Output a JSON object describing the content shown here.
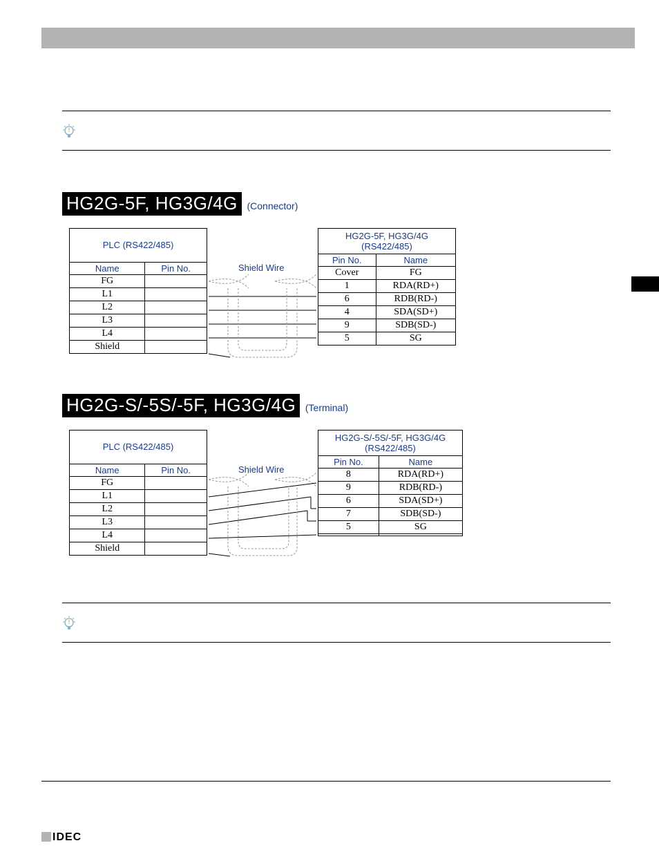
{
  "badge1": "HG2G-5F, HG3G/4G",
  "suffix1": "(Connector)",
  "badge2": "HG2G-S/-5S/-5F, HG3G/4G",
  "suffix2": "(Terminal)",
  "shieldLabel": "Shield Wire",
  "left": {
    "title": "PLC (RS422/485)",
    "hName": "Name",
    "hPin": "Pin No.",
    "rows": [
      "FG",
      "L1",
      "L2",
      "L3",
      "L4",
      "Shield"
    ]
  },
  "rightA": {
    "title1": "HG2G-5F, HG3G/4G",
    "title2": "(RS422/485)",
    "hPin": "Pin No.",
    "hName": "Name",
    "rows": [
      {
        "p": "Cover",
        "n": "FG"
      },
      {
        "p": "1",
        "n": "RDA(RD+)"
      },
      {
        "p": "6",
        "n": "RDB(RD-)"
      },
      {
        "p": "4",
        "n": "SDA(SD+)"
      },
      {
        "p": "9",
        "n": "SDB(SD-)"
      },
      {
        "p": "5",
        "n": "SG"
      }
    ]
  },
  "rightB": {
    "title1": "HG2G-S/-5S/-5F, HG3G/4G",
    "title2": "(RS422/485)",
    "hPin": "Pin No.",
    "hName": "Name",
    "rows": [
      {
        "p": "8",
        "n": "RDA(RD+)"
      },
      {
        "p": "9",
        "n": "RDB(RD-)"
      },
      {
        "p": "6",
        "n": "SDA(SD+)"
      },
      {
        "p": "7",
        "n": "SDB(SD-)"
      },
      {
        "p": "5",
        "n": "SG"
      },
      {
        "p": "",
        "n": ""
      }
    ]
  },
  "footer": "IDEC"
}
